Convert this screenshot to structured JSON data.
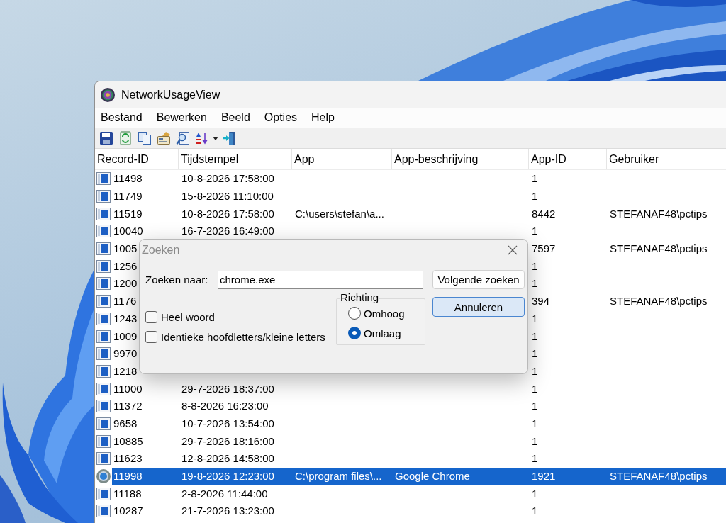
{
  "window": {
    "title": "NetworkUsageView"
  },
  "menu": [
    "Bestand",
    "Bewerken",
    "Beeld",
    "Opties",
    "Help"
  ],
  "table": {
    "columns": [
      "Record-ID",
      "Tijdstempel",
      "App",
      "App-beschrijving",
      "App-ID",
      "Gebruiker"
    ],
    "rows": [
      {
        "kind": "generic",
        "selected": false,
        "record_id": "11498",
        "timestamp": "10-8-2026 17:58:00",
        "app_id": "1"
      },
      {
        "kind": "generic",
        "selected": false,
        "record_id": "11749",
        "timestamp": "15-8-2026 11:10:00",
        "app_id": "1"
      },
      {
        "kind": "generic",
        "selected": false,
        "record_id": "11519",
        "timestamp": "10-8-2026 17:58:00",
        "app": "C:\\users\\stefan\\a...",
        "app_id": "8442",
        "user": "STEFANAF48\\pctips"
      },
      {
        "kind": "generic",
        "selected": false,
        "record_id": "10040",
        "timestamp": "16-7-2026 16:49:00",
        "app_id": "1"
      },
      {
        "kind": "generic",
        "selected": false,
        "record_id": "1005",
        "app_id": "7597",
        "user": "STEFANAF48\\pctips"
      },
      {
        "kind": "generic",
        "selected": false,
        "record_id": "1256",
        "app_id": "1"
      },
      {
        "kind": "generic",
        "selected": false,
        "record_id": "1200",
        "app_id": "1"
      },
      {
        "kind": "generic",
        "selected": false,
        "record_id": "1176",
        "app_id": "394",
        "user": "STEFANAF48\\pctips"
      },
      {
        "kind": "generic",
        "selected": false,
        "record_id": "1243",
        "app_id": "1"
      },
      {
        "kind": "generic",
        "selected": false,
        "record_id": "1009",
        "app_id": "1"
      },
      {
        "kind": "generic",
        "selected": false,
        "record_id": "9970",
        "app_id": "1"
      },
      {
        "kind": "generic",
        "selected": false,
        "record_id": "1218",
        "app_id": "1"
      },
      {
        "kind": "generic",
        "selected": false,
        "record_id": "11000",
        "timestamp": "29-7-2026 18:37:00",
        "app_id": "1"
      },
      {
        "kind": "generic",
        "selected": false,
        "record_id": "11372",
        "timestamp": "8-8-2026 16:23:00",
        "app_id": "1"
      },
      {
        "kind": "generic",
        "selected": false,
        "record_id": "9658",
        "timestamp": "10-7-2026 13:54:00",
        "app_id": "1"
      },
      {
        "kind": "generic",
        "selected": false,
        "record_id": "10885",
        "timestamp": "29-7-2026 18:16:00",
        "app_id": "1"
      },
      {
        "kind": "generic",
        "selected": false,
        "record_id": "11623",
        "timestamp": "12-8-2026 14:58:00",
        "app_id": "1"
      },
      {
        "kind": "logo",
        "selected": true,
        "record_id": "11998",
        "timestamp": "19-8-2026 12:23:00",
        "app": "C:\\program files\\...",
        "app_description": "Google Chrome",
        "app_id": "1921",
        "user": "STEFANAF48\\pctips"
      },
      {
        "kind": "generic",
        "selected": false,
        "record_id": "11188",
        "timestamp": "2-8-2026 11:44:00",
        "app_id": "1"
      },
      {
        "kind": "generic",
        "selected": false,
        "record_id": "10287",
        "timestamp": "21-7-2026 13:23:00",
        "app_id": "1"
      }
    ]
  },
  "dialog": {
    "title": "Zoeken",
    "search": {
      "label": "Zoeken naar:",
      "value": "chrome.exe"
    },
    "options": [
      {
        "label": "Heel woord",
        "checked": false
      },
      {
        "label": "Identieke hoofdletters/kleine letters",
        "checked": false
      }
    ],
    "direction": {
      "label": "Richting",
      "options": [
        {
          "label": "Omhoog",
          "selected": false
        },
        {
          "label": "Omlaag",
          "selected": true
        }
      ]
    },
    "buttons": [
      {
        "label": "Volgende zoeken",
        "default": false
      },
      {
        "label": "Annuleren",
        "default": true
      }
    ]
  }
}
